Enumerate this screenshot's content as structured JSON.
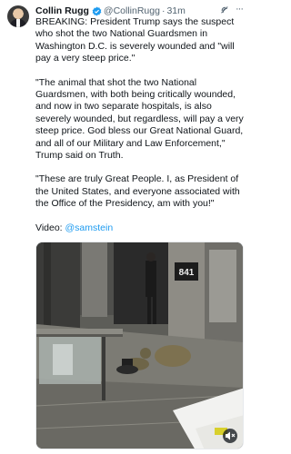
{
  "post": {
    "author_name": "Collin Rugg",
    "author_handle": "@CollinRugg",
    "separator": "·",
    "time": "31m",
    "paragraphs": [
      "BREAKING: President Trump says the suspect who shot the two National Guardsmen in Washington D.C. is severely wounded and \"will pay a very steep price.\"",
      "\"The animal that shot the two National Guardsmen, with both being critically wounded, and now in two separate hospitals, is also severely wounded, but regardless, will pay a very steep price. God bless our Great National Guard, and all of our Military and Law Enforcement,\" Trump said on Truth.",
      "\"These are truly Great People. I, as President of the United States, and everyone associated with the Office of the Presidency, am with you!\""
    ],
    "video_prefix": "Video: ",
    "video_credit": "@samstein",
    "sign_number": "841"
  },
  "icons": {
    "avatar": "avatar",
    "verified": "verified-badge-icon",
    "grok": "grok-icon",
    "more": "more-icon",
    "mute": "mute-icon"
  },
  "colors": {
    "accent": "#1d9bf0",
    "text": "#0f1419",
    "secondary": "#536471"
  }
}
